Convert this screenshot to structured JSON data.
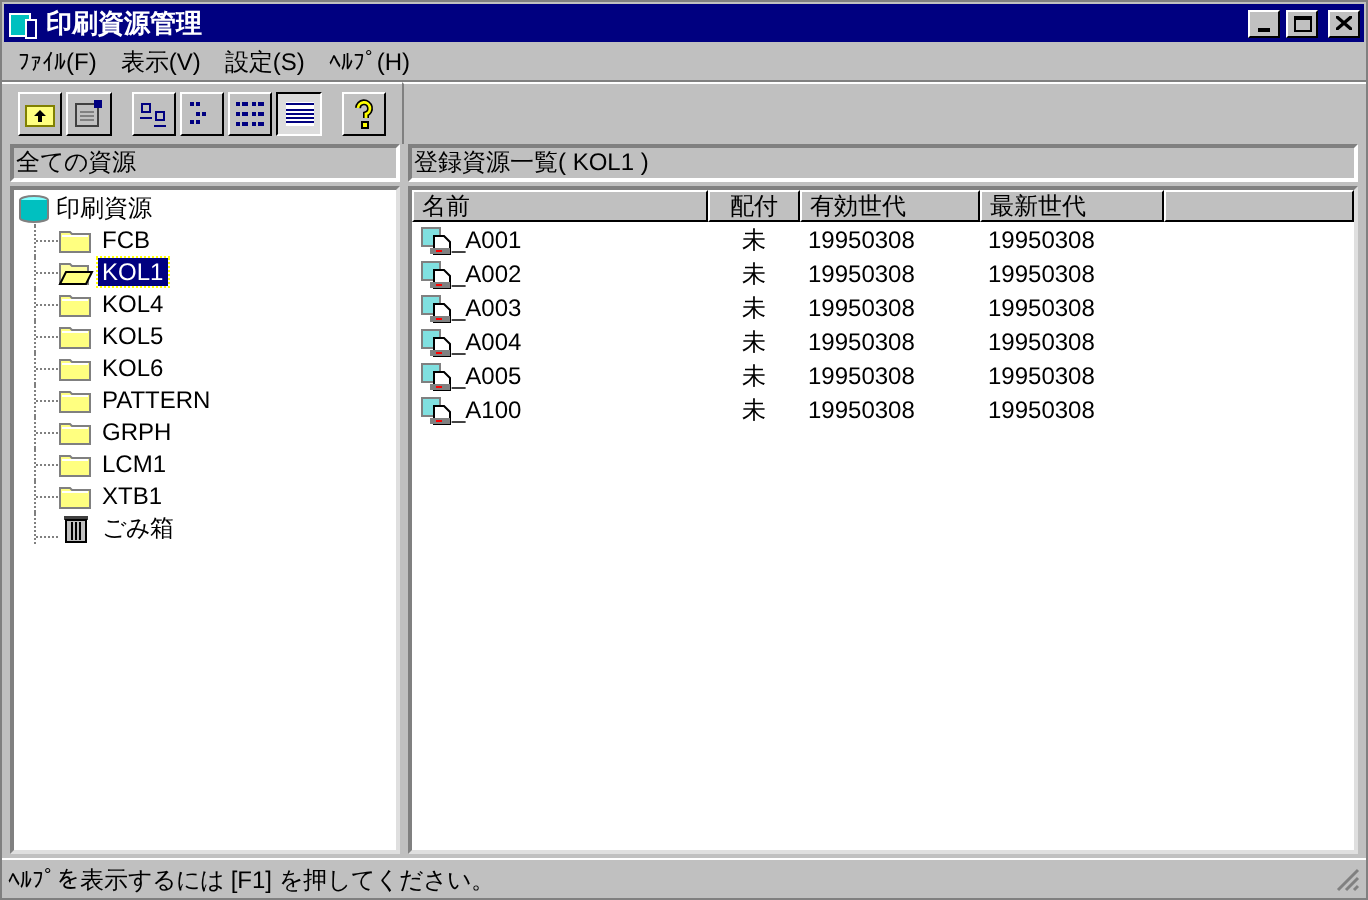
{
  "window": {
    "title": "印刷資源管理"
  },
  "menu": [
    "ﾌｧｲﾙ(F)",
    "表示(V)",
    "設定(S)",
    "ﾍﾙﾌﾟ(H)"
  ],
  "toolbar": [
    {
      "kind": "up",
      "pressed": false
    },
    {
      "kind": "props",
      "pressed": false
    },
    {
      "kind": "large",
      "pressed": false
    },
    {
      "kind": "small",
      "pressed": false
    },
    {
      "kind": "list",
      "pressed": false
    },
    {
      "kind": "details",
      "pressed": true
    },
    {
      "kind": "help",
      "pressed": false
    }
  ],
  "tree": {
    "header": "全ての資源",
    "root": {
      "label": "印刷資源",
      "children": [
        {
          "label": "FCB",
          "kind": "folder",
          "selected": false
        },
        {
          "label": "KOL1",
          "kind": "folder",
          "selected": true
        },
        {
          "label": "KOL4",
          "kind": "folder",
          "selected": false
        },
        {
          "label": "KOL5",
          "kind": "folder",
          "selected": false
        },
        {
          "label": "KOL6",
          "kind": "folder",
          "selected": false
        },
        {
          "label": "PATTERN",
          "kind": "folder",
          "selected": false
        },
        {
          "label": "GRPH",
          "kind": "folder",
          "selected": false
        },
        {
          "label": "LCM1",
          "kind": "folder",
          "selected": false
        },
        {
          "label": "XTB1",
          "kind": "folder",
          "selected": false
        },
        {
          "label": "ごみ箱",
          "kind": "trash",
          "selected": false
        }
      ]
    }
  },
  "list": {
    "header": "登録資源一覧( KOL1 )",
    "columns": [
      "名前",
      "配付",
      "有効世代",
      "最新世代"
    ],
    "rows": [
      [
        "_A001",
        "未",
        "19950308",
        "19950308"
      ],
      [
        "_A002",
        "未",
        "19950308",
        "19950308"
      ],
      [
        "_A003",
        "未",
        "19950308",
        "19950308"
      ],
      [
        "_A004",
        "未",
        "19950308",
        "19950308"
      ],
      [
        "_A005",
        "未",
        "19950308",
        "19950308"
      ],
      [
        "_A100",
        "未",
        "19950308",
        "19950308"
      ]
    ]
  },
  "status_bar": "ﾍﾙﾌﾟを表示するには [F1] を押してください。"
}
